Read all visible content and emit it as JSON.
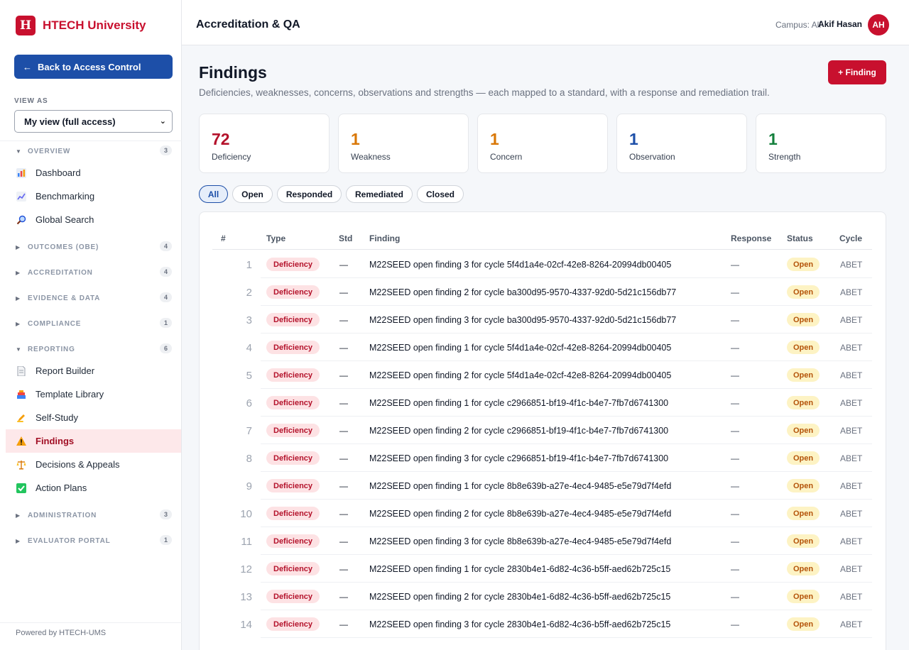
{
  "brand": {
    "logo_letter": "H",
    "name": "HTECH University",
    "color": "#c8102e"
  },
  "sidebar": {
    "back_button": "Back to Access Control",
    "view_as_label": "VIEW AS",
    "view_as_value": "My view (full access)",
    "groups": {
      "overview": {
        "label": "OVERVIEW",
        "count": "3",
        "expanded": true,
        "items": [
          {
            "label": "Dashboard",
            "icon": "bar-chart-icon"
          },
          {
            "label": "Benchmarking",
            "icon": "trend-chart-icon"
          },
          {
            "label": "Global Search",
            "icon": "magnifier-icon"
          }
        ]
      },
      "outcomes": {
        "label": "OUTCOMES (OBE)",
        "count": "4",
        "expanded": false
      },
      "accreditation": {
        "label": "ACCREDITATION",
        "count": "4",
        "expanded": false
      },
      "evidence": {
        "label": "EVIDENCE & DATA",
        "count": "4",
        "expanded": false
      },
      "compliance": {
        "label": "COMPLIANCE",
        "count": "1",
        "expanded": false
      },
      "reporting": {
        "label": "REPORTING",
        "count": "6",
        "expanded": true,
        "items": [
          {
            "label": "Report Builder",
            "icon": "document-icon"
          },
          {
            "label": "Template Library",
            "icon": "books-icon"
          },
          {
            "label": "Self-Study",
            "icon": "writing-hand-icon"
          },
          {
            "label": "Findings",
            "icon": "warning-icon",
            "active": true
          },
          {
            "label": "Decisions & Appeals",
            "icon": "scales-icon"
          },
          {
            "label": "Action Plans",
            "icon": "checkbox-icon"
          }
        ]
      },
      "administration": {
        "label": "ADMINISTRATION",
        "count": "3",
        "expanded": false
      },
      "evaluator": {
        "label": "EVALUATOR PORTAL",
        "count": "1",
        "expanded": false
      }
    },
    "powered_by": "Powered by HTECH-UMS"
  },
  "header": {
    "title": "Accreditation & QA",
    "campus": "Campus: All",
    "user_name": "Akif Hasan",
    "avatar_initials": "AH"
  },
  "main": {
    "title": "Findings",
    "description": "Deficiencies, weaknesses, concerns, observations and strengths — each mapped to a standard, with a response and remediation trail.",
    "add_button": "+ Finding",
    "stats": [
      {
        "value": "72",
        "label": "Deficiency",
        "color": "#b4122b"
      },
      {
        "value": "1",
        "label": "Weakness",
        "color": "#d97706"
      },
      {
        "value": "1",
        "label": "Concern",
        "color": "#d97706"
      },
      {
        "value": "1",
        "label": "Observation",
        "color": "#1d4fa8"
      },
      {
        "value": "1",
        "label": "Strength",
        "color": "#15803d"
      }
    ],
    "filters": [
      "All",
      "Open",
      "Responded",
      "Remediated",
      "Closed"
    ],
    "active_filter": "All",
    "table": {
      "columns": [
        "#",
        "Type",
        "Std",
        "Finding",
        "Response",
        "Status",
        "Cycle"
      ],
      "rows": [
        {
          "n": "1",
          "type": "Deficiency",
          "std": "—",
          "finding": "M22SEED open finding 3 for cycle 5f4d1a4e-02cf-42e8-8264-20994db00405",
          "response": "—",
          "status": "Open",
          "cycle": "ABET"
        },
        {
          "n": "2",
          "type": "Deficiency",
          "std": "—",
          "finding": "M22SEED open finding 2 for cycle ba300d95-9570-4337-92d0-5d21c156db77",
          "response": "—",
          "status": "Open",
          "cycle": "ABET"
        },
        {
          "n": "3",
          "type": "Deficiency",
          "std": "—",
          "finding": "M22SEED open finding 3 for cycle ba300d95-9570-4337-92d0-5d21c156db77",
          "response": "—",
          "status": "Open",
          "cycle": "ABET"
        },
        {
          "n": "4",
          "type": "Deficiency",
          "std": "—",
          "finding": "M22SEED open finding 1 for cycle 5f4d1a4e-02cf-42e8-8264-20994db00405",
          "response": "—",
          "status": "Open",
          "cycle": "ABET"
        },
        {
          "n": "5",
          "type": "Deficiency",
          "std": "—",
          "finding": "M22SEED open finding 2 for cycle 5f4d1a4e-02cf-42e8-8264-20994db00405",
          "response": "—",
          "status": "Open",
          "cycle": "ABET"
        },
        {
          "n": "6",
          "type": "Deficiency",
          "std": "—",
          "finding": "M22SEED open finding 1 for cycle c2966851-bf19-4f1c-b4e7-7fb7d6741300",
          "response": "—",
          "status": "Open",
          "cycle": "ABET"
        },
        {
          "n": "7",
          "type": "Deficiency",
          "std": "—",
          "finding": "M22SEED open finding 2 for cycle c2966851-bf19-4f1c-b4e7-7fb7d6741300",
          "response": "—",
          "status": "Open",
          "cycle": "ABET"
        },
        {
          "n": "8",
          "type": "Deficiency",
          "std": "—",
          "finding": "M22SEED open finding 3 for cycle c2966851-bf19-4f1c-b4e7-7fb7d6741300",
          "response": "—",
          "status": "Open",
          "cycle": "ABET"
        },
        {
          "n": "9",
          "type": "Deficiency",
          "std": "—",
          "finding": "M22SEED open finding 1 for cycle 8b8e639b-a27e-4ec4-9485-e5e79d7f4efd",
          "response": "—",
          "status": "Open",
          "cycle": "ABET"
        },
        {
          "n": "10",
          "type": "Deficiency",
          "std": "—",
          "finding": "M22SEED open finding 2 for cycle 8b8e639b-a27e-4ec4-9485-e5e79d7f4efd",
          "response": "—",
          "status": "Open",
          "cycle": "ABET"
        },
        {
          "n": "11",
          "type": "Deficiency",
          "std": "—",
          "finding": "M22SEED open finding 3 for cycle 8b8e639b-a27e-4ec4-9485-e5e79d7f4efd",
          "response": "—",
          "status": "Open",
          "cycle": "ABET"
        },
        {
          "n": "12",
          "type": "Deficiency",
          "std": "—",
          "finding": "M22SEED open finding 1 for cycle 2830b4e1-6d82-4c36-b5ff-aed62b725c15",
          "response": "—",
          "status": "Open",
          "cycle": "ABET"
        },
        {
          "n": "13",
          "type": "Deficiency",
          "std": "—",
          "finding": "M22SEED open finding 2 for cycle 2830b4e1-6d82-4c36-b5ff-aed62b725c15",
          "response": "—",
          "status": "Open",
          "cycle": "ABET"
        },
        {
          "n": "14",
          "type": "Deficiency",
          "std": "—",
          "finding": "M22SEED open finding 3 for cycle 2830b4e1-6d82-4c36-b5ff-aed62b725c15",
          "response": "—",
          "status": "Open",
          "cycle": "ABET"
        }
      ]
    }
  }
}
